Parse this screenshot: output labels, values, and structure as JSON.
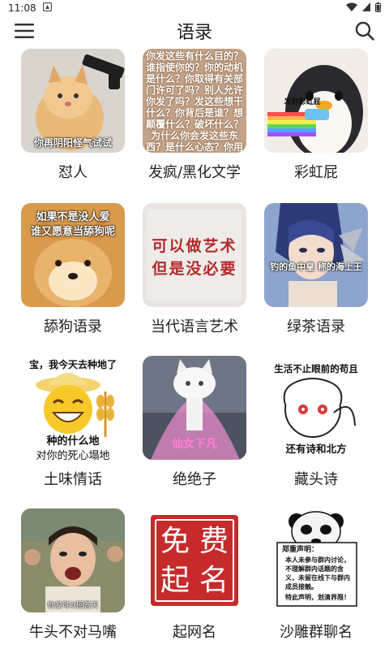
{
  "status": {
    "time": "11:08"
  },
  "header": {
    "title": "语录"
  },
  "categories": [
    {
      "label": "怼人",
      "caption": "你再阴阳怪气试试"
    },
    {
      "label": "发疯/黑化文学",
      "caption": "你发这些有什么目的？谁指使你的？你的动机是什么？你取得有关部门许可了吗？别人允许你发了吗？发这些想干什么？你背后是谁？想颠覆什么？破坏什么？为什么你会发这些东西？是什么心态？你用"
    },
    {
      "label": "彩虹屁",
      "caption": "发射彩虹屁"
    },
    {
      "label": "舔狗语录",
      "caption_line1": "如果不是没人爱",
      "caption_line2": "谁又愿意当舔狗呢"
    },
    {
      "label": "当代语言艺术",
      "caption_line1": "可以做艺术",
      "caption_line2": "但是没必要"
    },
    {
      "label": "绿茶语录",
      "caption": "钓的鱼中皇  称的海上王"
    },
    {
      "label": "土味情话",
      "caption_top": "宝，我今天去种地了",
      "caption_mid": "种的什么地",
      "caption_bottom": "对你的死心塌地"
    },
    {
      "label": "绝绝子",
      "caption": "仙女下凡"
    },
    {
      "label": "藏头诗",
      "caption_top": "生活不止眼前的苟且",
      "caption_bottom": "还有诗和北方"
    },
    {
      "label": "牛头不对马嘴",
      "caption": "你发可以回答天"
    },
    {
      "label": "起网名",
      "seal_chars": [
        "免",
        "费",
        "起",
        "名"
      ]
    },
    {
      "label": "沙雕群聊名",
      "sign_title": "郑重声明：",
      "sign_body": "本人未参与群内讨论，不理解群内话题的含义，未留在线下与群内成员接触。",
      "sign_footer": "特此声明，划清界限！"
    }
  ]
}
